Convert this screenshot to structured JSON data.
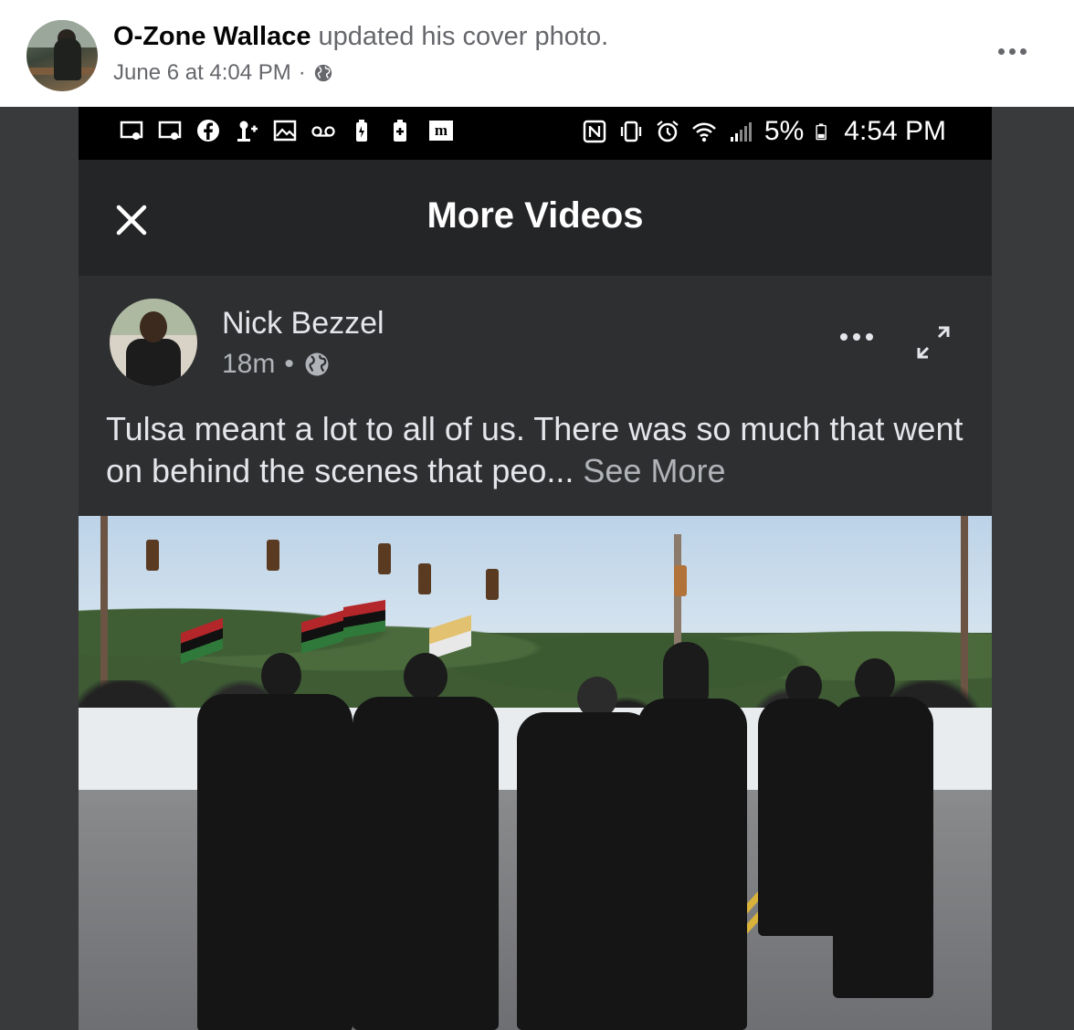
{
  "post": {
    "author": "O-Zone Wallace",
    "action": " updated his cover photo.",
    "timestamp": "June 6 at 4:04 PM",
    "separator": "·",
    "privacy_icon": "globe-icon",
    "menu_icon": "more-options-icon"
  },
  "cover": {
    "status_bar": {
      "left_icons": [
        "cast-icon",
        "cast-icon",
        "facebook-icon",
        "person-add-icon",
        "image-icon",
        "voicemail-icon",
        "battery-saver-icon",
        "battery-plus-icon",
        "m-app-icon"
      ],
      "right_icons": [
        "nfc-icon",
        "vibrate-icon",
        "alarm-icon",
        "wifi-icon",
        "signal-icon"
      ],
      "battery": "5%",
      "time": "4:54 PM"
    },
    "app_bar": {
      "title": "More Videos",
      "close_icon": "close-icon"
    },
    "inner_post": {
      "author": "Nick Bezzel",
      "time": "18m",
      "separator": "•",
      "text": "Tulsa meant a lot to all of us.  There was so much that went on behind the scenes that peo...",
      "see_more": " See More"
    }
  },
  "colors": {
    "facebook_text": "#050505",
    "secondary_text": "#65676b",
    "dark_background": "#2e2f31",
    "status_bar": "#000000"
  }
}
